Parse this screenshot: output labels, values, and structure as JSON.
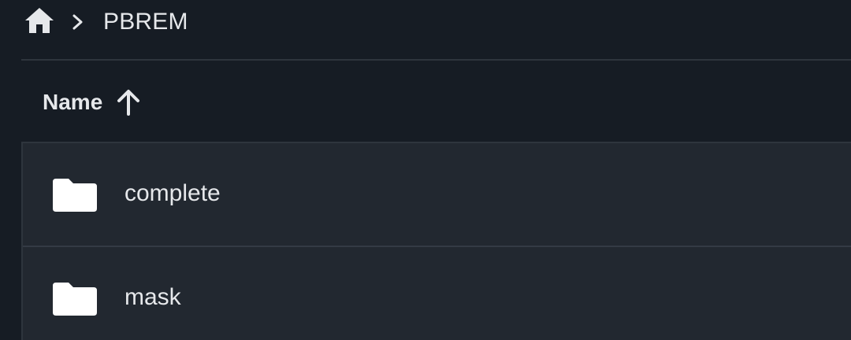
{
  "breadcrumb": {
    "home_icon": "home-icon",
    "separator_icon": "chevron-right-icon",
    "current": "PBREM"
  },
  "table": {
    "header": {
      "name_label": "Name",
      "sort_icon": "arrow-up-icon",
      "sort_direction": "ascending"
    },
    "rows": [
      {
        "icon": "folder-icon",
        "name": "complete"
      },
      {
        "icon": "folder-icon",
        "name": "mask"
      }
    ]
  },
  "colors": {
    "background": "#161c24",
    "row_background": "#222830",
    "divider": "#2e353d",
    "text": "#e6e8eb"
  }
}
